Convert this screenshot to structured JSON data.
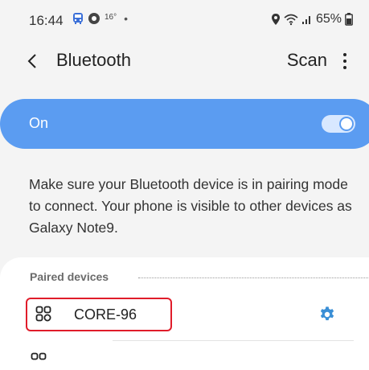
{
  "status_bar": {
    "time": "16:44",
    "temperature": "16°",
    "dot": "•",
    "battery": "65%"
  },
  "header": {
    "title": "Bluetooth",
    "scan_label": "Scan"
  },
  "bluetooth_toggle": {
    "label": "On",
    "state": "on",
    "accent_color": "#5b9cf1"
  },
  "description": "Make sure your Bluetooth device is in pairing mode to connect. Your phone is visible to other devices as Galaxy Note9.",
  "paired_devices": {
    "header": "Paired devices",
    "devices": [
      {
        "name": "CORE-96",
        "icon": "grid-device-icon",
        "highlighted": true
      }
    ]
  },
  "colors": {
    "highlight_border": "#e01c2a",
    "settings_icon": "#3a8fd6"
  }
}
